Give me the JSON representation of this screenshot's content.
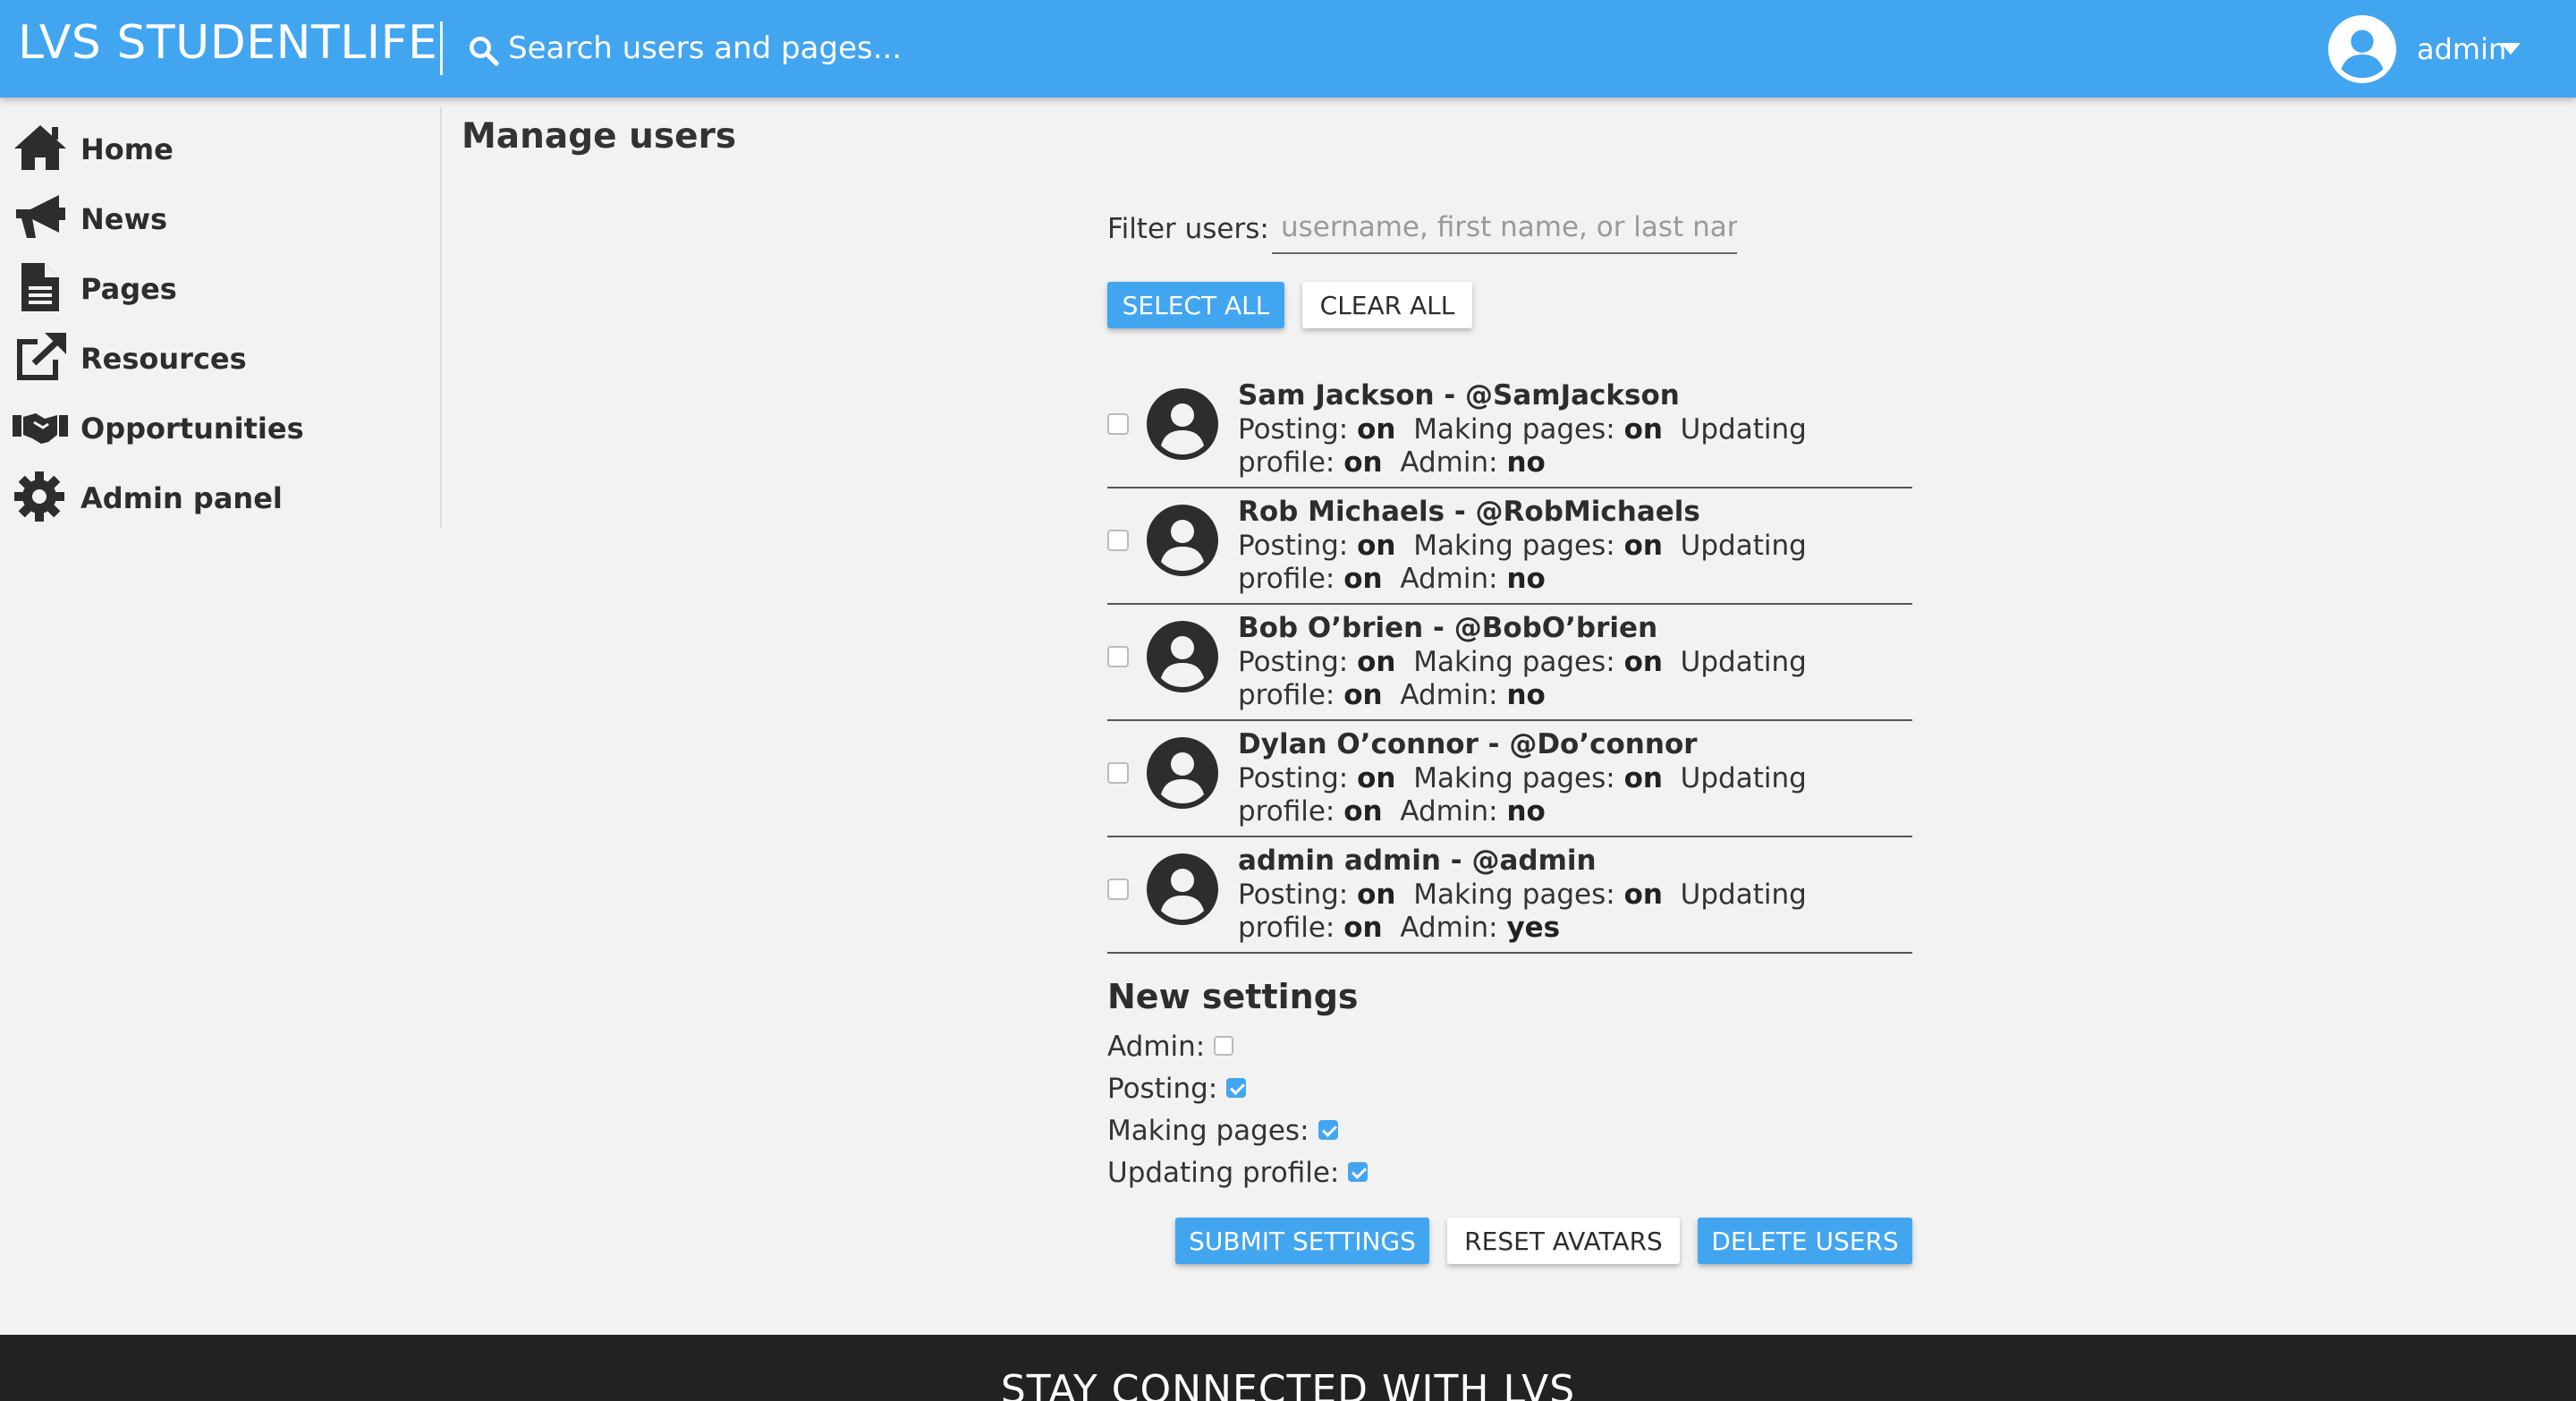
{
  "header": {
    "brand": "LVS STUDENTLIFE",
    "search_placeholder": "Search users and pages...",
    "search_icon": "search-icon",
    "user_icon": "user-circle-icon",
    "user_name": "admin",
    "caret_icon": "caret-down-icon"
  },
  "sidebar": {
    "items": [
      {
        "label": "Home",
        "icon": "home-icon"
      },
      {
        "label": "News",
        "icon": "megaphone-icon"
      },
      {
        "label": "Pages",
        "icon": "document-icon"
      },
      {
        "label": "Resources",
        "icon": "external-link-icon"
      },
      {
        "label": "Opportunities",
        "icon": "handshake-icon"
      },
      {
        "label": "Admin panel",
        "icon": "gear-icon"
      }
    ]
  },
  "main": {
    "title": "Manage users",
    "filter_label": "Filter users:",
    "filter_placeholder": "username, first name, or last name",
    "select_all": "SELECT ALL",
    "clear_all": "CLEAR ALL",
    "users": [
      {
        "name": "Sam Jackson - @SamJackson",
        "posting": "on",
        "making_pages": "on",
        "updating_profile": "on",
        "admin": "no",
        "checked": false
      },
      {
        "name": "Rob Michaels - @RobMichaels",
        "posting": "on",
        "making_pages": "on",
        "updating_profile": "on",
        "admin": "no",
        "checked": false
      },
      {
        "name": "Bob O’brien - @BobO’brien",
        "posting": "on",
        "making_pages": "on",
        "updating_profile": "on",
        "admin": "no",
        "checked": false
      },
      {
        "name": "Dylan O’connor - @Do’connor",
        "posting": "on",
        "making_pages": "on",
        "updating_profile": "on",
        "admin": "no",
        "checked": false
      },
      {
        "name": "admin admin - @admin",
        "posting": "on",
        "making_pages": "on",
        "updating_profile": "on",
        "admin": "yes",
        "checked": false
      }
    ],
    "perm_labels": {
      "posting": "Posting:",
      "making_pages": "Making pages:",
      "updating_profile": "Updating profile:",
      "admin": "Admin:"
    },
    "new_settings": {
      "title": "New settings",
      "admin_label": "Admin:",
      "admin_checked": false,
      "posting_label": "Posting:",
      "posting_checked": true,
      "making_pages_label": "Making pages:",
      "making_pages_checked": true,
      "updating_profile_label": "Updating profile:",
      "updating_profile_checked": true
    },
    "submit_settings": "SUBMIT SETTINGS",
    "reset_avatars": "RESET AVATARS",
    "delete_users": "DELETE USERS"
  },
  "footer": {
    "text": "STAY CONNECTED WITH LVS"
  },
  "colors": {
    "accent": "#42a5f0",
    "footer_bg": "#222222",
    "page_bg": "#f2f2f2"
  }
}
